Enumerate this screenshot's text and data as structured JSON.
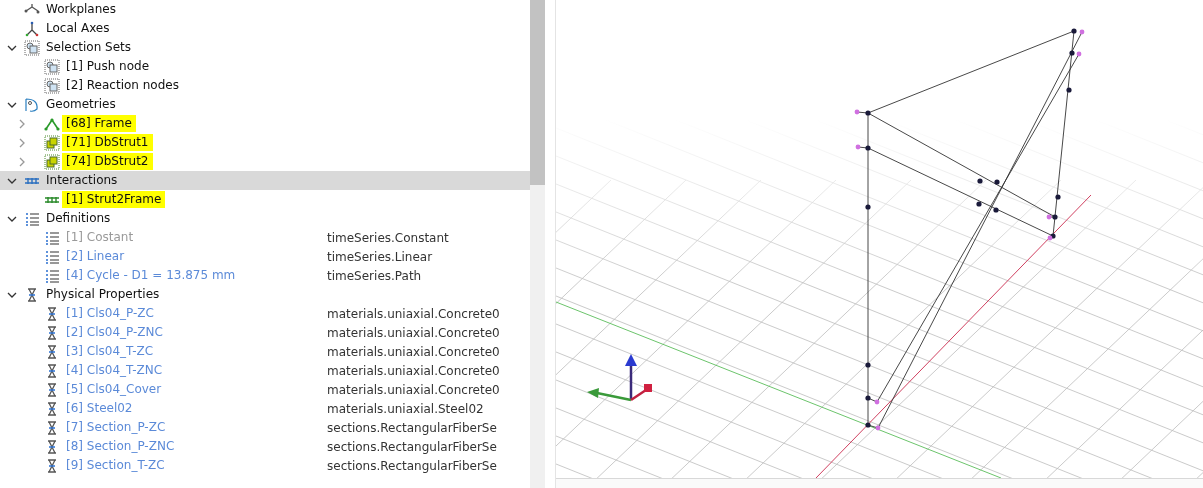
{
  "tree": [
    {
      "label": "Workplanes",
      "kind": "workplane",
      "selected": false
    },
    {
      "label": "Local Axes",
      "kind": "axes",
      "selected": false
    },
    {
      "label": "Selection Sets",
      "kind": "selection",
      "expanded": true,
      "selected": false,
      "children": [
        {
          "label": "[1] Push node",
          "kind": "selection",
          "highlighted": false,
          "disabled": false,
          "has_children": false
        },
        {
          "label": "[2] Reaction nodes",
          "kind": "selection",
          "highlighted": false,
          "disabled": false,
          "has_children": false
        }
      ]
    },
    {
      "label": "Geometries",
      "kind": "geometry",
      "expanded": true,
      "selected": false,
      "children": [
        {
          "label": "[68] Frame",
          "kind": "frame",
          "highlighted": true,
          "disabled": false,
          "has_children": true
        },
        {
          "label": "[71] DbStrut1",
          "kind": "strut",
          "highlighted": true,
          "disabled": false,
          "has_children": true
        },
        {
          "label": "[74] DbStrut2",
          "kind": "strut",
          "highlighted": true,
          "disabled": false,
          "has_children": true
        }
      ]
    },
    {
      "label": "Interactions",
      "kind": "interaction",
      "expanded": true,
      "selected": true,
      "children": [
        {
          "label": "[1] Strut2Frame",
          "kind": "interaction",
          "highlighted": true,
          "disabled": false,
          "has_children": false
        }
      ]
    },
    {
      "label": "Definitions",
      "kind": "definitions",
      "expanded": true,
      "selected": false,
      "children": [
        {
          "label": "[1] Costant",
          "kind": "timeseries",
          "highlighted": false,
          "disabled": true,
          "has_children": false,
          "type": "timeSeries.Constant"
        },
        {
          "label": "[2] Linear",
          "kind": "timeseries",
          "highlighted": false,
          "disabled": false,
          "has_children": false,
          "type": "timeSeries.Linear"
        },
        {
          "label": "[4] Cycle - D1 = 13.875 mm",
          "kind": "timeseries",
          "highlighted": false,
          "disabled": false,
          "has_children": false,
          "type": "timeSeries.Path"
        }
      ]
    },
    {
      "label": "Physical Properties",
      "kind": "property",
      "expanded": true,
      "selected": false,
      "children": [
        {
          "label": "[1] Cls04_P-ZC",
          "kind": "property",
          "highlighted": false,
          "disabled": false,
          "has_children": false,
          "type": "materials.uniaxial.Concrete0"
        },
        {
          "label": "[2] Cls04_P-ZNC",
          "kind": "property",
          "highlighted": false,
          "disabled": false,
          "has_children": false,
          "type": "materials.uniaxial.Concrete0"
        },
        {
          "label": "[3] Cls04_T-ZC",
          "kind": "property",
          "highlighted": false,
          "disabled": false,
          "has_children": false,
          "type": "materials.uniaxial.Concrete0"
        },
        {
          "label": "[4] Cls04_T-ZNC",
          "kind": "property",
          "highlighted": false,
          "disabled": false,
          "has_children": false,
          "type": "materials.uniaxial.Concrete0"
        },
        {
          "label": "[5] Cls04_Cover",
          "kind": "property",
          "highlighted": false,
          "disabled": false,
          "has_children": false,
          "type": "materials.uniaxial.Concrete0"
        },
        {
          "label": "[6] Steel02",
          "kind": "property",
          "highlighted": false,
          "disabled": false,
          "has_children": false,
          "type": "materials.uniaxial.Steel02"
        },
        {
          "label": "[7] Section_P-ZC",
          "kind": "property",
          "highlighted": false,
          "disabled": false,
          "has_children": false,
          "type": "sections.RectangularFiberSe"
        },
        {
          "label": "[8] Section_P-ZNC",
          "kind": "property",
          "highlighted": false,
          "disabled": false,
          "has_children": false,
          "type": "sections.RectangularFiberSe"
        },
        {
          "label": "[9] Section_T-ZC",
          "kind": "property",
          "highlighted": false,
          "disabled": false,
          "has_children": false,
          "type": "sections.RectangularFiberSe"
        }
      ]
    }
  ]
}
